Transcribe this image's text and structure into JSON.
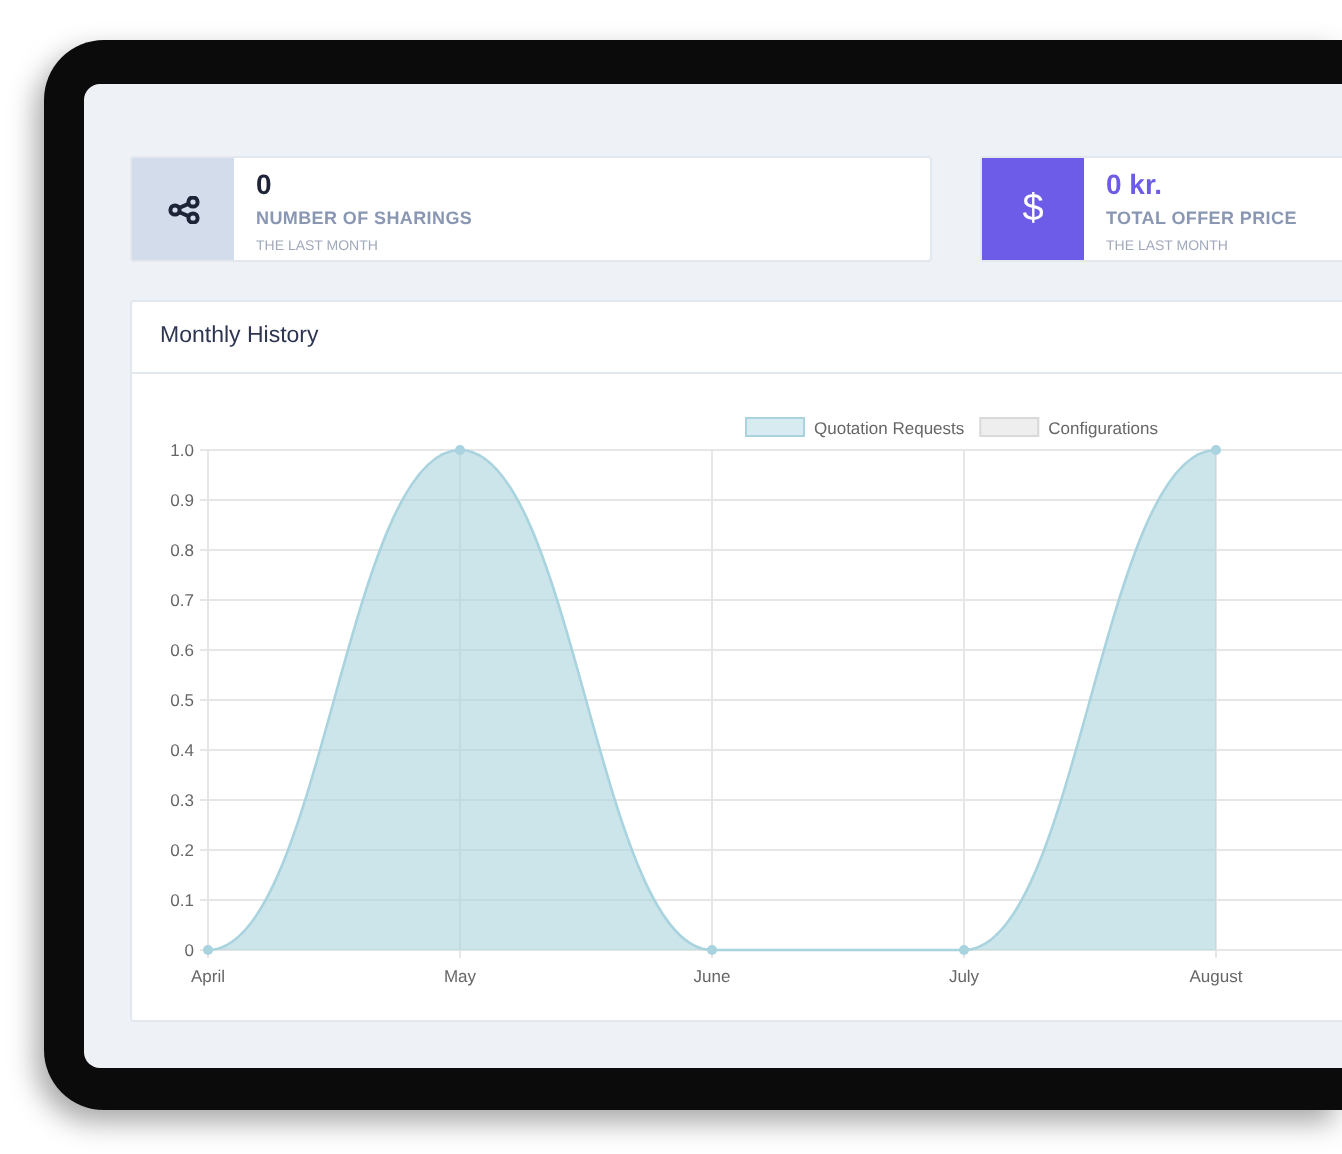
{
  "stats": [
    {
      "kind": "share",
      "value": "0",
      "label": "NUMBER OF SHARINGS",
      "period": "THE LAST MONTH",
      "color": "#d3dcea"
    },
    {
      "kind": "dollar",
      "symbol": "$",
      "value": "0 kr.",
      "label": "TOTAL OFFER PRICE",
      "period": "THE LAST MONTH",
      "color": "#6c5ce7"
    }
  ],
  "history": {
    "title": "Monthly History",
    "chart_data": {
      "type": "area",
      "categories": [
        "April",
        "May",
        "June",
        "July",
        "August"
      ],
      "series": [
        {
          "name": "Quotation Requests",
          "color": "#a9d3de",
          "values": [
            0,
            1,
            0,
            0,
            1
          ]
        },
        {
          "name": "Configurations",
          "color": "#d9d9d9",
          "values": [
            null,
            null,
            null,
            null,
            null
          ]
        }
      ],
      "ylim": [
        0,
        1
      ],
      "grid": true,
      "yticks": [
        {
          "value": 0,
          "label": "0"
        },
        {
          "value": 0.1,
          "label": "0.1"
        },
        {
          "value": 0.2,
          "label": "0.2"
        },
        {
          "value": 0.3,
          "label": "0.3"
        },
        {
          "value": 0.4,
          "label": "0.4"
        },
        {
          "value": 0.5,
          "label": "0.5"
        },
        {
          "value": 0.6,
          "label": "0.6"
        },
        {
          "value": 0.7,
          "label": "0.7"
        },
        {
          "value": 0.8,
          "label": "0.8"
        },
        {
          "value": 0.9,
          "label": "0.9"
        },
        {
          "value": 1,
          "label": "1.0"
        }
      ]
    }
  }
}
